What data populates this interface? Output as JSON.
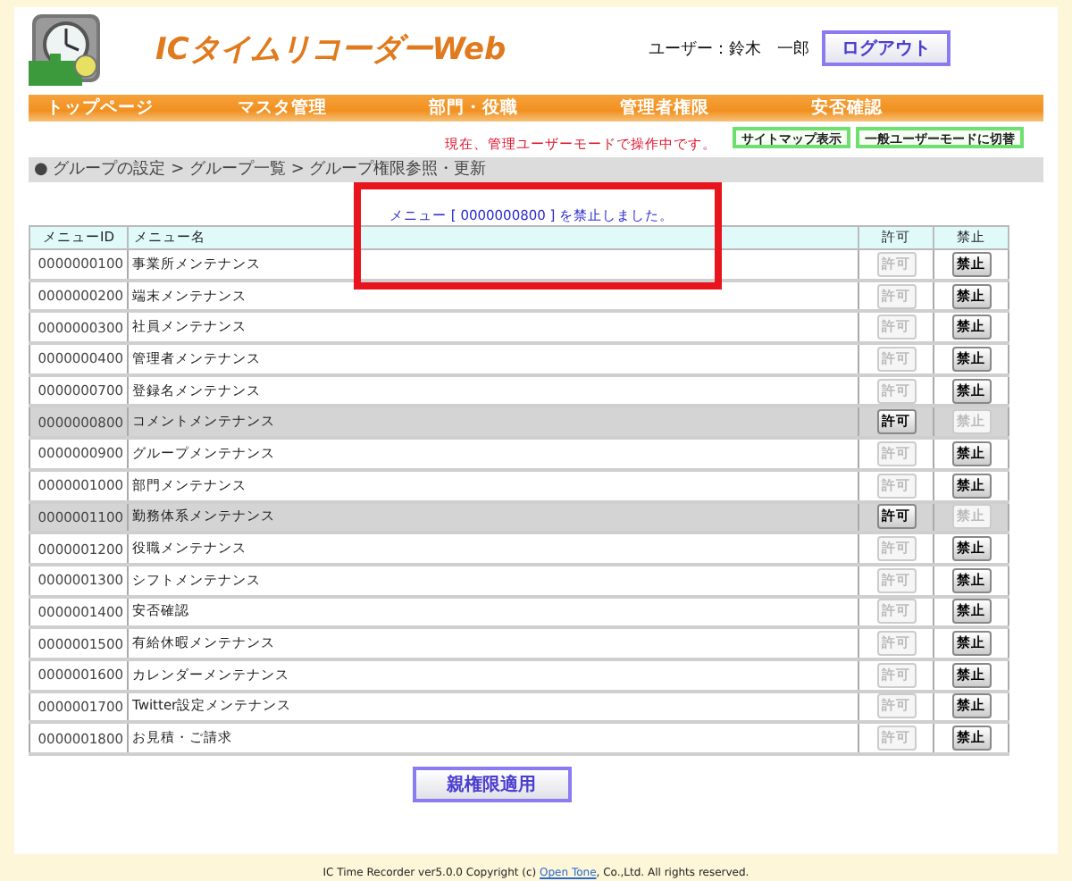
{
  "header": {
    "app_title": "ICタイムリコーダーWeb",
    "user_label": "ユーザー：鈴木　一郎",
    "logout_button": "ログアウト"
  },
  "nav": [
    "トップページ",
    "マスタ管理",
    "部門・役職",
    "管理者権限",
    "安否確認"
  ],
  "mode_notice": "現在、管理ユーザーモードで操作中です。",
  "mode_buttons": [
    "サイトマップ表示",
    "一般ユーザーモードに切替"
  ],
  "breadcrumb": "● グループの設定 > グループ一覧 > グループ権限参照・更新",
  "message": "メニュー [ 0000000800 ] を禁止しました。",
  "table": {
    "columns": [
      "メニューID",
      "メニュー名",
      "許可",
      "禁止"
    ],
    "rows": [
      {
        "id": "0000000100",
        "name": "事業所メンテナンス",
        "allow": "許可",
        "deny": "禁止",
        "forbidden": false
      },
      {
        "id": "0000000200",
        "name": "端末メンテナンス",
        "allow": "許可",
        "deny": "禁止",
        "forbidden": false
      },
      {
        "id": "0000000300",
        "name": "社員メンテナンス",
        "allow": "許可",
        "deny": "禁止",
        "forbidden": false
      },
      {
        "id": "0000000400",
        "name": "管理者メンテナンス",
        "allow": "許可",
        "deny": "禁止",
        "forbidden": false
      },
      {
        "id": "0000000700",
        "name": "登録名メンテナンス",
        "allow": "許可",
        "deny": "禁止",
        "forbidden": false
      },
      {
        "id": "0000000800",
        "name": "コメントメンテナンス",
        "allow": "許可",
        "deny": "禁止",
        "forbidden": true
      },
      {
        "id": "0000000900",
        "name": "グループメンテナンス",
        "allow": "許可",
        "deny": "禁止",
        "forbidden": false
      },
      {
        "id": "0000001000",
        "name": "部門メンテナンス",
        "allow": "許可",
        "deny": "禁止",
        "forbidden": false
      },
      {
        "id": "0000001100",
        "name": "勤務体系メンテナンス",
        "allow": "許可",
        "deny": "禁止",
        "forbidden": true
      },
      {
        "id": "0000001200",
        "name": "役職メンテナンス",
        "allow": "許可",
        "deny": "禁止",
        "forbidden": false
      },
      {
        "id": "0000001300",
        "name": "シフトメンテナンス",
        "allow": "許可",
        "deny": "禁止",
        "forbidden": false
      },
      {
        "id": "0000001400",
        "name": "安否確認",
        "allow": "許可",
        "deny": "禁止",
        "forbidden": false
      },
      {
        "id": "0000001500",
        "name": "有給休暇メンテナンス",
        "allow": "許可",
        "deny": "禁止",
        "forbidden": false
      },
      {
        "id": "0000001600",
        "name": "カレンダーメンテナンス",
        "allow": "許可",
        "deny": "禁止",
        "forbidden": false
      },
      {
        "id": "0000001700",
        "name": "Twitter設定メンテナンス",
        "allow": "許可",
        "deny": "禁止",
        "forbidden": false
      },
      {
        "id": "0000001800",
        "name": "お見積・ご請求",
        "allow": "許可",
        "deny": "禁止",
        "forbidden": false
      }
    ]
  },
  "apply_button": "親権限適用",
  "footer": {
    "text_before": "IC Time Recorder ver5.0.0 Copyright (c) ",
    "link": "Open Tone",
    "text_after": ", Co.,Ltd. All rights reserved."
  }
}
